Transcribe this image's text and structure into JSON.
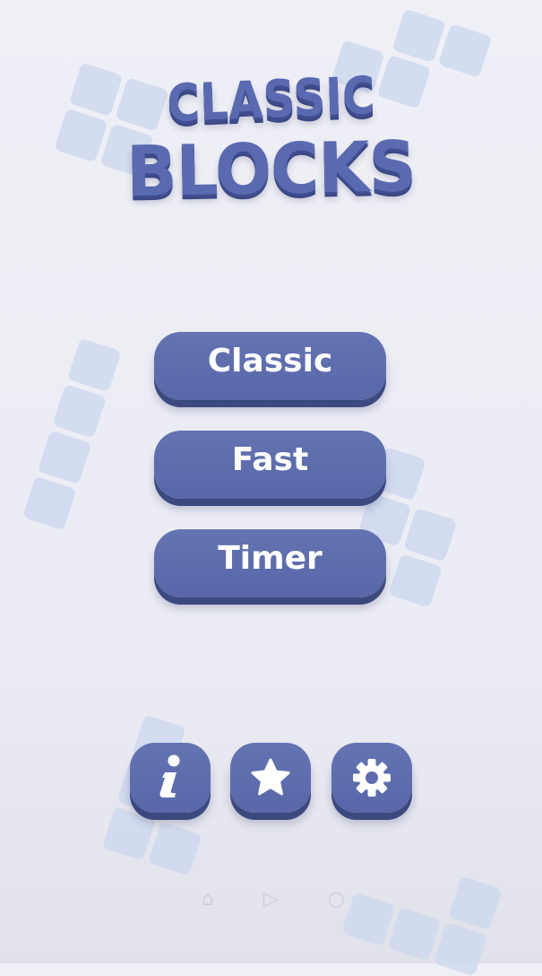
{
  "logo": {
    "line1": "CLASSIC",
    "line2": "BLOCKS"
  },
  "menu": {
    "classic_label": "Classic",
    "fast_label": "Fast",
    "timer_label": "Timer"
  },
  "icons": {
    "info": "info-icon",
    "rate": "star-icon",
    "settings": "gear-icon"
  },
  "colors": {
    "button": "#5d6dad",
    "button_shadow": "#3c497f",
    "logo": "#5a6ab0",
    "block": "#cfd8ef",
    "background": "#ededf4"
  }
}
